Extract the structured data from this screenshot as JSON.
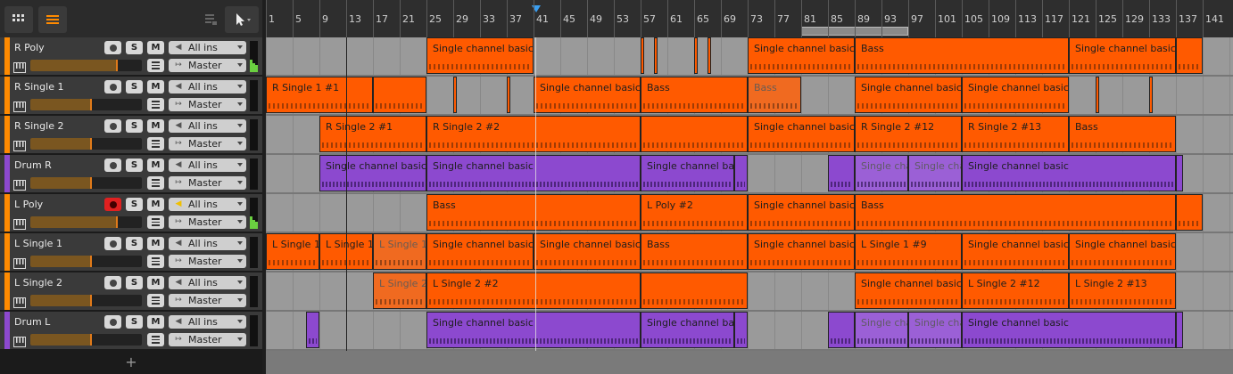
{
  "toolbar": {
    "grid_icon": "grid-icon",
    "list_icon": "list-icon",
    "pointer_icon": "pointer-icon",
    "accent": "#ff8a00"
  },
  "ruler": {
    "bars": [
      "1",
      "5",
      "9",
      "13",
      "17",
      "21",
      "25",
      "29",
      "33",
      "37",
      "41",
      "45",
      "49",
      "53",
      "57",
      "61",
      "65",
      "69",
      "73",
      "77",
      "81",
      "85",
      "89",
      "93",
      "97",
      "101",
      "105",
      "109",
      "113",
      "117",
      "121",
      "125",
      "129",
      "133",
      "137",
      "141"
    ]
  },
  "tracks": [
    {
      "name": "R Poly",
      "color": "#ff8a00",
      "input": "All ins",
      "output": "Master",
      "armed": false,
      "monitor": false,
      "meter": true,
      "volume": 0.78
    },
    {
      "name": "R Single 1",
      "color": "#ff8a00",
      "input": "All ins",
      "output": "Master",
      "armed": false,
      "monitor": false,
      "meter": false,
      "volume": 0.55
    },
    {
      "name": "R Single 2",
      "color": "#ff8a00",
      "input": "All ins",
      "output": "Master",
      "armed": false,
      "monitor": false,
      "meter": false,
      "volume": 0.55
    },
    {
      "name": "Drum R",
      "color": "#8c49cf",
      "input": "All ins",
      "output": "Master",
      "armed": false,
      "monitor": false,
      "meter": false,
      "volume": 0.55
    },
    {
      "name": "L Poly",
      "color": "#ff8a00",
      "input": "All ins",
      "output": "Master",
      "armed": true,
      "monitor": true,
      "meter": true,
      "volume": 0.78
    },
    {
      "name": "L Single 1",
      "color": "#ff8a00",
      "input": "All ins",
      "output": "Master",
      "armed": false,
      "monitor": false,
      "meter": false,
      "volume": 0.55
    },
    {
      "name": "L Single 2",
      "color": "#ff8a00",
      "input": "All ins",
      "output": "Master",
      "armed": false,
      "monitor": false,
      "meter": false,
      "volume": 0.55
    },
    {
      "name": "Drum L",
      "color": "#8c49cf",
      "input": "All ins",
      "output": "Master",
      "armed": false,
      "monitor": false,
      "meter": false,
      "volume": 0.55
    }
  ],
  "buttons": {
    "solo": "S",
    "mute": "M",
    "add": "+"
  },
  "clips": [
    [
      {
        "s": 25,
        "e": 41,
        "name": "Single channel basic"
      },
      {
        "s": 57,
        "e": 57.5,
        "name": ""
      },
      {
        "s": 59,
        "e": 59.5,
        "name": ""
      },
      {
        "s": 65,
        "e": 65.5,
        "name": ""
      },
      {
        "s": 67,
        "e": 67.5,
        "name": ""
      },
      {
        "s": 73,
        "e": 89,
        "name": "Single channel basic"
      },
      {
        "s": 89,
        "e": 121,
        "name": "Bass"
      },
      {
        "s": 121,
        "e": 137,
        "name": "Single channel basic"
      },
      {
        "s": 137,
        "e": 141,
        "name": ""
      }
    ],
    [
      {
        "s": 1,
        "e": 17,
        "name": "R  Single 1 #1"
      },
      {
        "s": 17,
        "e": 25,
        "name": ""
      },
      {
        "s": 29,
        "e": 29.5,
        "name": ""
      },
      {
        "s": 37,
        "e": 37.5,
        "name": ""
      },
      {
        "s": 41,
        "e": 57,
        "name": "Single channel basic"
      },
      {
        "s": 57,
        "e": 73,
        "name": "Bass"
      },
      {
        "s": 73,
        "e": 81,
        "name": "Bass",
        "dim": true
      },
      {
        "s": 89,
        "e": 105,
        "name": "Single channel basic"
      },
      {
        "s": 105,
        "e": 121,
        "name": "Single channel basic"
      },
      {
        "s": 125,
        "e": 125.5,
        "name": ""
      },
      {
        "s": 133,
        "e": 133.5,
        "name": ""
      }
    ],
    [
      {
        "s": 9,
        "e": 25,
        "name": "R  Single 2 #1"
      },
      {
        "s": 25,
        "e": 57,
        "name": "R  Single 2 #2"
      },
      {
        "s": 57,
        "e": 73,
        "name": ""
      },
      {
        "s": 73,
        "e": 89,
        "name": "Single channel basic"
      },
      {
        "s": 89,
        "e": 105,
        "name": "R  Single 2 #12"
      },
      {
        "s": 105,
        "e": 121,
        "name": "R  Single 2 #13"
      },
      {
        "s": 121,
        "e": 137,
        "name": "Bass"
      }
    ],
    [
      {
        "s": 9,
        "e": 25,
        "name": "Single channel basic"
      },
      {
        "s": 25,
        "e": 57,
        "name": "Single channel basic"
      },
      {
        "s": 57,
        "e": 71,
        "name": "Single channel basic"
      },
      {
        "s": 71,
        "e": 73,
        "name": ""
      },
      {
        "s": 85,
        "e": 89,
        "name": ""
      },
      {
        "s": 89,
        "e": 97,
        "name": "Single channel basic",
        "dim": true
      },
      {
        "s": 97,
        "e": 105,
        "name": "Single channel basic",
        "dim": true
      },
      {
        "s": 105,
        "e": 137,
        "name": "Single channel basic"
      },
      {
        "s": 137,
        "e": 138,
        "name": ""
      }
    ],
    [
      {
        "s": 25,
        "e": 57,
        "name": "Bass"
      },
      {
        "s": 57,
        "e": 73,
        "name": "L Poly #2"
      },
      {
        "s": 73,
        "e": 89,
        "name": "Single channel basic"
      },
      {
        "s": 89,
        "e": 137,
        "name": "Bass"
      },
      {
        "s": 137,
        "e": 141,
        "name": ""
      }
    ],
    [
      {
        "s": 1,
        "e": 9,
        "name": "L  Single 1"
      },
      {
        "s": 9,
        "e": 17,
        "name": "L  Single 1"
      },
      {
        "s": 17,
        "e": 25,
        "name": "L  Single 1",
        "dim": true
      },
      {
        "s": 25,
        "e": 41,
        "name": "Single channel basic"
      },
      {
        "s": 41,
        "e": 57,
        "name": "Single channel basic"
      },
      {
        "s": 57,
        "e": 73,
        "name": "Bass"
      },
      {
        "s": 73,
        "e": 89,
        "name": "Single channel basic"
      },
      {
        "s": 89,
        "e": 105,
        "name": "L  Single 1 #9"
      },
      {
        "s": 105,
        "e": 121,
        "name": "Single channel basic"
      },
      {
        "s": 121,
        "e": 137,
        "name": "Single channel basic"
      }
    ],
    [
      {
        "s": 17,
        "e": 25,
        "name": "L  Single 2",
        "dim": true
      },
      {
        "s": 25,
        "e": 57,
        "name": "L  Single 2 #2"
      },
      {
        "s": 57,
        "e": 73,
        "name": ""
      },
      {
        "s": 89,
        "e": 105,
        "name": "Single channel basic"
      },
      {
        "s": 105,
        "e": 121,
        "name": "L  Single 2 #12"
      },
      {
        "s": 121,
        "e": 137,
        "name": "L  Single 2 #13"
      }
    ],
    [
      {
        "s": 7,
        "e": 9,
        "name": ""
      },
      {
        "s": 25,
        "e": 57,
        "name": "Single channel basic"
      },
      {
        "s": 57,
        "e": 71,
        "name": "Single channel basic"
      },
      {
        "s": 71,
        "e": 73,
        "name": ""
      },
      {
        "s": 85,
        "e": 89,
        "name": ""
      },
      {
        "s": 89,
        "e": 97,
        "name": "Single channel basic",
        "dim": true
      },
      {
        "s": 97,
        "e": 105,
        "name": "Single channel basic",
        "dim": true
      },
      {
        "s": 105,
        "e": 137,
        "name": "Single channel basic"
      },
      {
        "s": 137,
        "e": 138,
        "name": ""
      }
    ]
  ]
}
